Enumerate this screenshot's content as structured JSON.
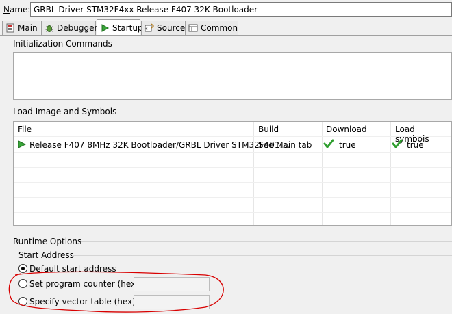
{
  "name": {
    "label_first": "N",
    "label_rest": "ame:",
    "value": "GRBL Driver STM32F4xx Release F407 32K Bootloader"
  },
  "tabs": [
    {
      "label": "Main",
      "icon": "main-icon"
    },
    {
      "label": "Debugger",
      "icon": "debugger-bug-icon"
    },
    {
      "label": "Startup",
      "icon": "startup-play-icon",
      "active": true
    },
    {
      "label": "Source",
      "icon": "source-icon"
    },
    {
      "label": "Common",
      "icon": "common-icon"
    }
  ],
  "init": {
    "title": "Initialization Commands"
  },
  "load": {
    "title": "Load Image and Symbols",
    "columns": [
      "File",
      "Build",
      "Download",
      "Load symbols"
    ],
    "rows": [
      {
        "file": "Release F407 8MHz 32K Bootloader/GRBL Driver STM32F401....",
        "build": "See Main tab",
        "download": "true",
        "load_symbols": "true"
      }
    ]
  },
  "runtime": {
    "title": "Runtime Options",
    "start_address": {
      "title": "Start Address",
      "options": [
        {
          "label": "Default start address",
          "selected": true
        },
        {
          "label": "Set program counter (hex):",
          "selected": false
        },
        {
          "label": "Specify vector table (hex):",
          "selected": false
        }
      ]
    }
  },
  "colors": {
    "annotation_red": "#d80000",
    "play_green": "#3aa63a",
    "check_green": "#2e9e2e"
  }
}
